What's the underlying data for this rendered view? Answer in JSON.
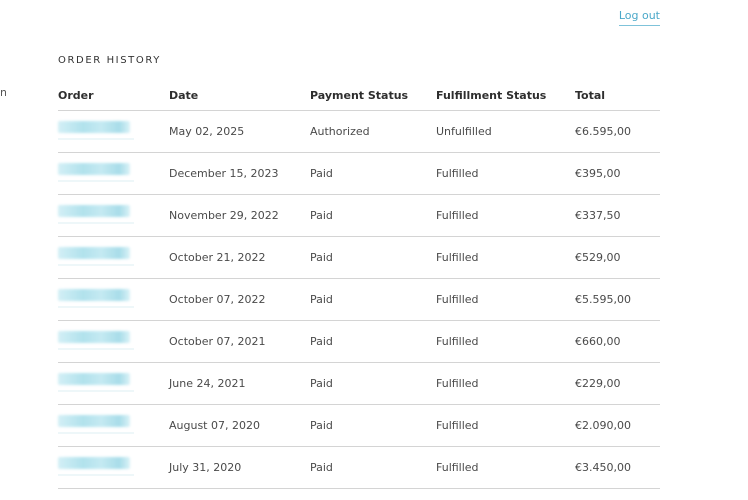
{
  "nav": {
    "logout_label": "Log out",
    "side_fragment": "n"
  },
  "orders": {
    "title": "ORDER HISTORY",
    "columns": [
      "Order",
      "Date",
      "Payment Status",
      "Fulfillment Status",
      "Total"
    ],
    "rows": [
      {
        "date": "May 02, 2025",
        "payment": "Authorized",
        "fulfillment": "Unfulfilled",
        "total": "€6.595,00"
      },
      {
        "date": "December 15, 2023",
        "payment": "Paid",
        "fulfillment": "Fulfilled",
        "total": "€395,00"
      },
      {
        "date": "November 29, 2022",
        "payment": "Paid",
        "fulfillment": "Fulfilled",
        "total": "€337,50"
      },
      {
        "date": "October 21, 2022",
        "payment": "Paid",
        "fulfillment": "Fulfilled",
        "total": "€529,00"
      },
      {
        "date": "October 07, 2022",
        "payment": "Paid",
        "fulfillment": "Fulfilled",
        "total": "€5.595,00"
      },
      {
        "date": "October 07, 2021",
        "payment": "Paid",
        "fulfillment": "Fulfilled",
        "total": "€660,00"
      },
      {
        "date": "June 24, 2021",
        "payment": "Paid",
        "fulfillment": "Fulfilled",
        "total": "€229,00"
      },
      {
        "date": "August 07, 2020",
        "payment": "Paid",
        "fulfillment": "Fulfilled",
        "total": "€2.090,00"
      },
      {
        "date": "July 31, 2020",
        "payment": "Paid",
        "fulfillment": "Fulfilled",
        "total": "€3.450,00"
      }
    ]
  },
  "colors": {
    "link": "#4aa8c9",
    "redacted": "#a9dfeb"
  }
}
